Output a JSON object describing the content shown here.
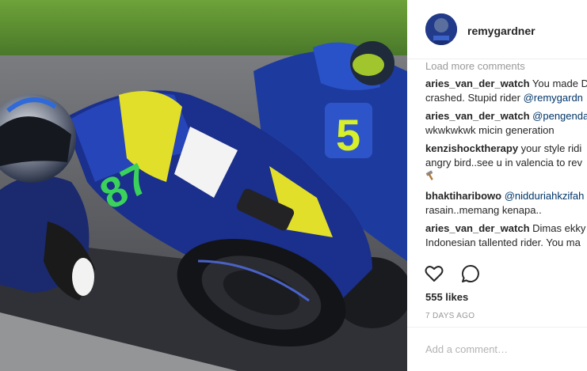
{
  "post": {
    "username": "remygardner",
    "load_more": "Load more comments",
    "comments": [
      {
        "user": "aries_van_der_watch",
        "text1": "You made D",
        "text2": "crashed. Stupid rider ",
        "mention2": "@remygardn"
      },
      {
        "user": "aries_van_der_watch",
        "mention1": "@pengenda",
        "text2": "wkwkwkwk micin generation"
      },
      {
        "user": "kenzishocktherapy",
        "text1": "your style ridi",
        "text2": "angry bird..see u in valencia to rev"
      },
      {
        "user": "bhaktiharibowo",
        "mention1": "@nidduriahkzifah",
        "text2": "rasain..memang kenapa.."
      },
      {
        "user": "aries_van_der_watch",
        "text1": "Dimas ekky",
        "text2": "Indonesian tallented rider. You ma"
      }
    ],
    "likes": "555 likes",
    "timestamp": "7 DAYS AGO",
    "add_comment_placeholder": "Add a comment…"
  },
  "photo": {
    "bike_numbers": [
      "87",
      "5"
    ],
    "icons": [
      "heart-icon",
      "comment-icon",
      "hammer-icon"
    ]
  },
  "colors": {
    "link": "#003569",
    "muted": "#999999",
    "text": "#262626"
  }
}
